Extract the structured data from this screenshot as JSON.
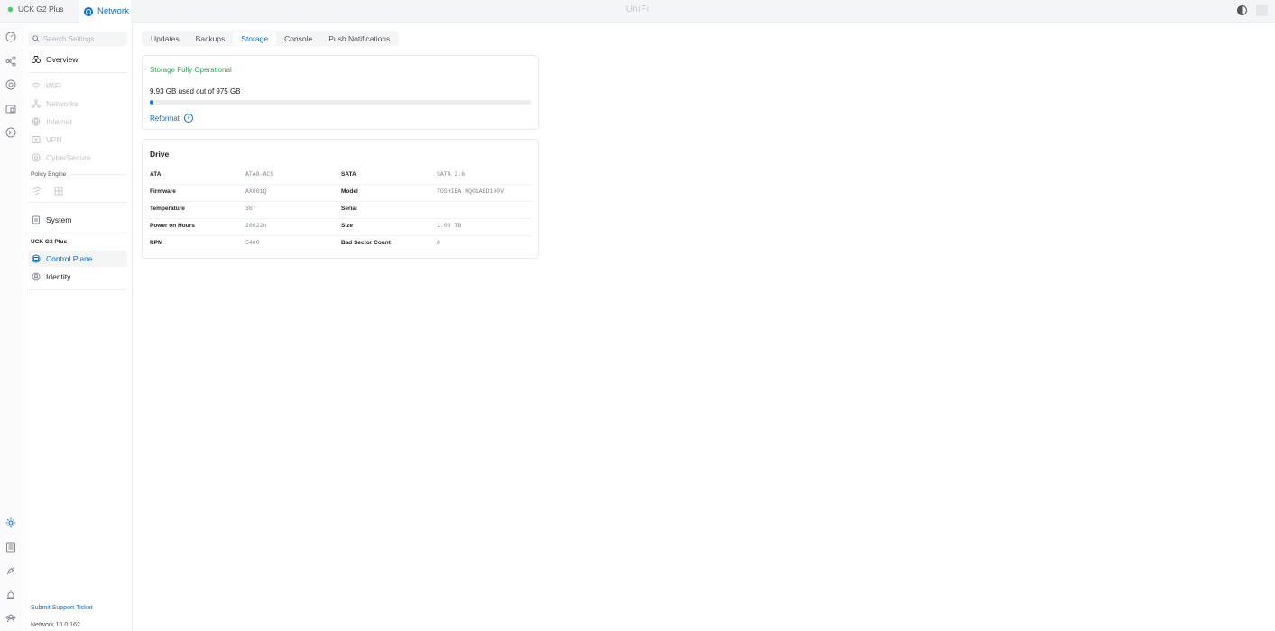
{
  "topbar": {
    "console_name": "UCK G2 Plus",
    "app_name": "Network",
    "brand": "UniFi"
  },
  "rail": {
    "icons": [
      "dashboard-icon",
      "topology-icon",
      "devices-icon",
      "clients-icon",
      "insights-icon",
      "settings-icon",
      "logs-icon",
      "integrations-icon",
      "alerts-icon",
      "admins-icon"
    ],
    "active": "settings-icon"
  },
  "sidebar": {
    "search_placeholder": "Search Settings",
    "overview": "Overview",
    "items": [
      {
        "label": "WiFi",
        "icon": "wifi-icon"
      },
      {
        "label": "Networks",
        "icon": "networks-icon"
      },
      {
        "label": "Internet",
        "icon": "internet-icon"
      },
      {
        "label": "VPN",
        "icon": "vpn-icon"
      },
      {
        "label": "CyberSecure",
        "icon": "cybersecure-icon"
      }
    ],
    "policy_engine": "Policy Engine",
    "system": "System",
    "console_section": "UCK G2 Plus",
    "control_plane": "Control Plane",
    "identity": "Identity",
    "support_link": "Submit Support Ticket",
    "version": "Network 10.0.162"
  },
  "tabs": [
    "Updates",
    "Backups",
    "Storage",
    "Console",
    "Push Notifications"
  ],
  "active_tab": "Storage",
  "storage": {
    "status": "Storage Fully Operational",
    "usage_text": "9.93 GB used out of 975 GB",
    "used_fraction": 0.0102,
    "reformat": "Reformat"
  },
  "drive": {
    "title": "Drive",
    "rows": [
      {
        "k1": "ATA",
        "v1": "ATA8-ACS",
        "k2": "SATA",
        "v2": "SATA 2.6"
      },
      {
        "k1": "Firmware",
        "v1": "AX001Q",
        "k2": "Model",
        "v2": "TOSHIBA MQ01ABD100V"
      },
      {
        "k1": "Temperature",
        "v1": "36°",
        "k2": "Serial",
        "v2": ""
      },
      {
        "k1": "Power on Hours",
        "v1": "20022h",
        "k2": "Size",
        "v2": "1.00 TB"
      },
      {
        "k1": "RPM",
        "v1": "5400",
        "k2": "Bad Sector Count",
        "v2": "0"
      }
    ]
  },
  "colors": {
    "accent": "#006fff",
    "success": "#38a35a",
    "status_dot": "#38cc65"
  }
}
